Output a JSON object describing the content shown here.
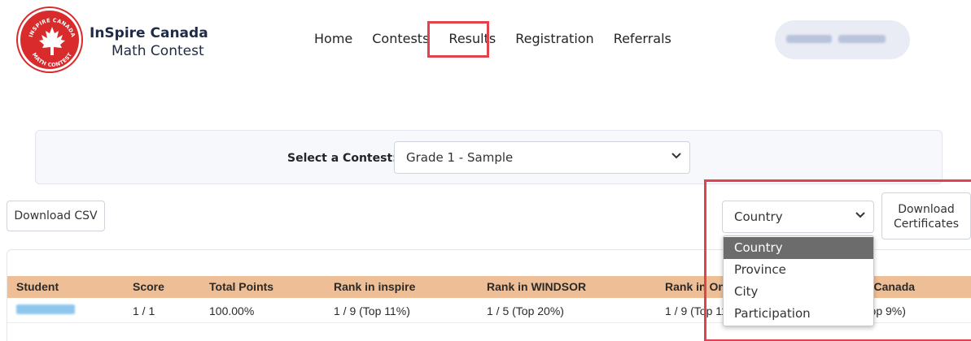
{
  "brand": {
    "line1": "InSpire Canada",
    "line2": "Math Contest",
    "logo_text_top": "INSPIRE CANADA",
    "logo_text_bottom": "MATH CONTEST",
    "logo_color": "#d92b2b"
  },
  "nav": {
    "home": "Home",
    "contests": "Contests",
    "results": "Results",
    "registration": "Registration",
    "referrals": "Referrals",
    "highlight_color": "#e0434b"
  },
  "contest_select": {
    "label": "Select a Contest:",
    "value": "Grade 1 - Sample"
  },
  "actions": {
    "download_csv": "Download CSV",
    "download_certificates_line1": "Download",
    "download_certificates_line2": "Certificates"
  },
  "scope_select": {
    "value": "Country",
    "options": [
      "Country",
      "Province",
      "City",
      "Participation"
    ]
  },
  "table": {
    "headers": [
      "Student",
      "Score",
      "Total Points",
      "Rank in inspire",
      "Rank in WINDSOR",
      "Rank in Ontario",
      "Rank in Canada"
    ],
    "row": {
      "score": "1 / 1",
      "total_points": "100.00%",
      "rank_inspire": "1 / 9 (Top 11%)",
      "rank_windsor": "1 / 5 (Top 20%)",
      "rank_province": "1 / 9 (Top 11%)",
      "rank_canada": "1 / 11 (Top 9%)"
    },
    "header_color": "#eebf96"
  }
}
